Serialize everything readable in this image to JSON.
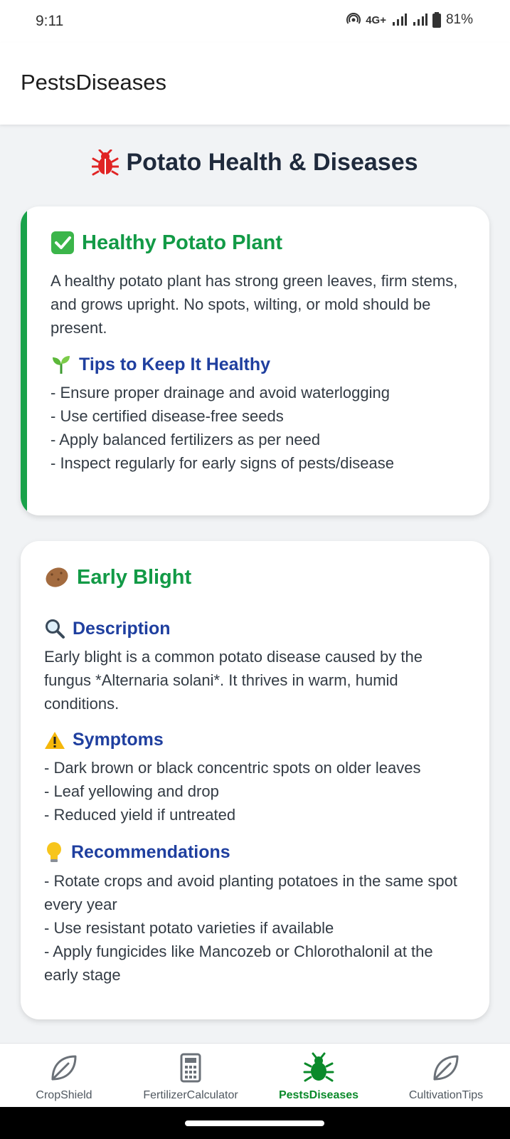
{
  "status_bar": {
    "time": "9:11",
    "network": "4G+",
    "battery": "81%"
  },
  "app_bar": {
    "title": "PestsDiseases"
  },
  "page": {
    "heading": "Potato Health & Diseases",
    "heading_icon": "bug-icon"
  },
  "healthy_card": {
    "title": "Healthy Potato Plant",
    "title_icon": "check-icon",
    "description": "A healthy potato plant has strong green leaves, firm stems, and grows upright. No spots, wilting, or mold should be present.",
    "tips_title": "Tips to Keep It Healthy",
    "tips_icon": "seedling-icon",
    "tips": [
      "- Ensure proper drainage and avoid waterlogging",
      "- Use certified disease-free seeds",
      "- Apply balanced fertilizers as per need",
      "- Inspect regularly for early signs of pests/disease"
    ],
    "accent_color": "#19a24a"
  },
  "disease_card": {
    "title": "Early Blight",
    "title_icon": "potato-icon",
    "description_title": "Description",
    "description_icon": "magnifier-icon",
    "description": "Early blight is a common potato disease caused by the fungus *Alternaria solani*. It thrives in warm, humid conditions.",
    "symptoms_title": "Symptoms",
    "symptoms_icon": "warning-icon",
    "symptoms": [
      "- Dark brown or black concentric spots on older leaves",
      "- Leaf yellowing and drop",
      "- Reduced yield if untreated"
    ],
    "recommendations_title": "Recommendations",
    "recommendations_icon": "lightbulb-icon",
    "recommendations": [
      "- Rotate crops and avoid planting potatoes in the same spot every year",
      "- Use resistant potato varieties if available",
      "- Apply fungicides like Mancozeb or Chlorothalonil at the early stage"
    ]
  },
  "bottom_nav": {
    "items": [
      {
        "label": "CropShield",
        "icon": "leaf-icon"
      },
      {
        "label": "FertilizerCalculator",
        "icon": "calculator-icon"
      },
      {
        "label": "PestsDiseases",
        "icon": "bug-icon",
        "active": true
      },
      {
        "label": "CultivationTips",
        "icon": "leaf-icon"
      }
    ],
    "active_color": "#0a8a2a"
  }
}
